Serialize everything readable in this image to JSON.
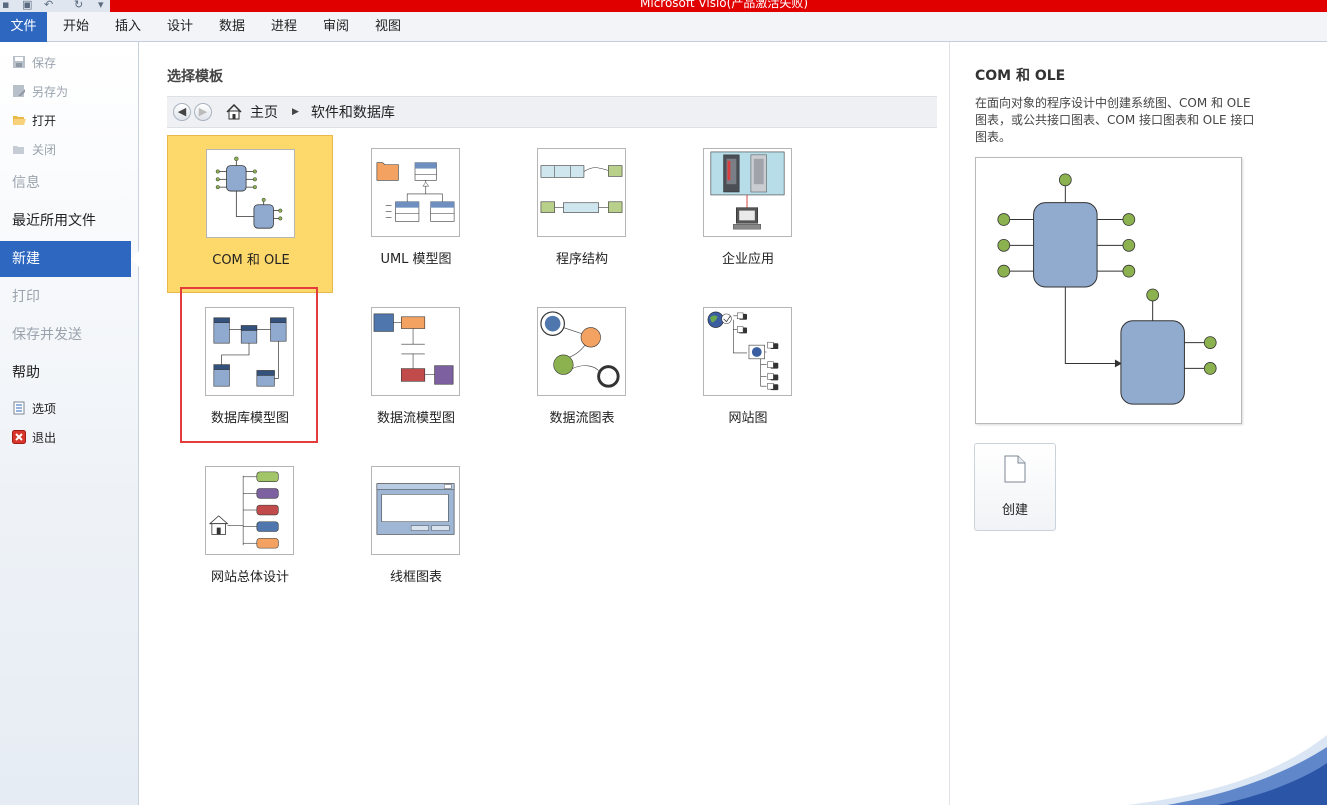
{
  "window": {
    "title": "Microsoft Visio(产品激活失败)"
  },
  "ribbon": {
    "tabs": [
      "文件",
      "开始",
      "插入",
      "设计",
      "数据",
      "进程",
      "审阅",
      "视图"
    ]
  },
  "nav": {
    "save": "保存",
    "save_as": "另存为",
    "open": "打开",
    "close": "关闭",
    "info": "信息",
    "recent": "最近所用文件",
    "new": "新建",
    "print": "打印",
    "save_send": "保存并发送",
    "help": "帮助",
    "options": "选项",
    "exit": "退出"
  },
  "main": {
    "section_title": "选择模板",
    "breadcrumb": {
      "home": "主页",
      "current": "软件和数据库"
    },
    "templates": [
      {
        "label": "COM 和 OLE",
        "selected": true
      },
      {
        "label": "UML 模型图"
      },
      {
        "label": "程序结构"
      },
      {
        "label": "企业应用"
      },
      {
        "label": "数据库模型图",
        "highlighted": true
      },
      {
        "label": "数据流模型图"
      },
      {
        "label": "数据流图表"
      },
      {
        "label": "网站图"
      },
      {
        "label": "网站总体设计"
      },
      {
        "label": "线框图表"
      }
    ]
  },
  "detail": {
    "title": "COM 和 OLE",
    "description": "在面向对象的程序设计中创建系统图、COM 和 OLE 图表，或公共接口图表、COM 接口图表和 OLE 接口图表。",
    "create_label": "创建"
  },
  "colors": {
    "accent": "#2d67c0",
    "selected_tile": "#fdd86b",
    "highlight_border": "#e23c3c",
    "title_bar": "#e00000"
  }
}
